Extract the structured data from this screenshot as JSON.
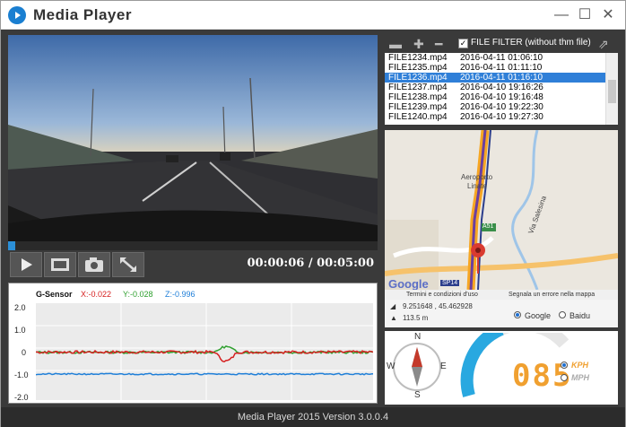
{
  "window": {
    "title": "Media Player",
    "minimize": "—",
    "maximize": "☐",
    "close": "✕"
  },
  "video": {
    "progress": 0.02,
    "time_display": "00:00:06 / 00:05:00",
    "controls": [
      "play-icon",
      "film-icon",
      "camera-icon",
      "expand-icon"
    ]
  },
  "gsensor": {
    "title": "G-Sensor",
    "x_label": "X:-0.022",
    "y_label": "Y:-0.028",
    "z_label": "Z:-0.996",
    "y_ticks": [
      "2.0",
      "1.0",
      "0",
      "-1.0",
      "-2.0"
    ],
    "colors": {
      "x": "#d62020",
      "y": "#2fa02f",
      "z": "#1f7fd8"
    }
  },
  "files": {
    "filter_label": "FILE FILTER (without thm file)",
    "filter_checked": true,
    "list": [
      {
        "name": "FILE1234.mp4",
        "date": "2016-04-11 01:06:10"
      },
      {
        "name": "FILE1235.mp4",
        "date": "2016-04-11 01:11:10"
      },
      {
        "name": "FILE1236.mp4",
        "date": "2016-04-11 01:16:10",
        "selected": true
      },
      {
        "name": "FILE1237.mp4",
        "date": "2016-04-10 19:16:26"
      },
      {
        "name": "FILE1238.mp4",
        "date": "2016-04-10 19:16:48"
      },
      {
        "name": "FILE1239.mp4",
        "date": "2016-04-10 19:22:30"
      },
      {
        "name": "FILE1240.mp4",
        "date": "2016-04-10 19:27:30"
      }
    ]
  },
  "map": {
    "labels": {
      "aeroporto": "Aeroporto",
      "linate": "Linate",
      "salesina": "Via Salesina",
      "a51": "A51",
      "sp14": "SP14",
      "google": "Google",
      "terms": "Termini e condizioni d'uso",
      "report": "Segnala un errore nella mappa"
    },
    "coords": "9.251648 , 45.462928",
    "altitude": "113.5 m",
    "provider_google": "Google",
    "provider_baidu": "Baidu",
    "selected_provider": "Google"
  },
  "speed": {
    "value": "085",
    "unit_kph": "KPH",
    "unit_mph": "MPH",
    "selected_unit": "KPH",
    "compass": {
      "n": "N",
      "e": "E",
      "s": "S",
      "w": "W"
    }
  },
  "footer": {
    "text": "Media Player 2015 Version 3.0.0.4"
  }
}
